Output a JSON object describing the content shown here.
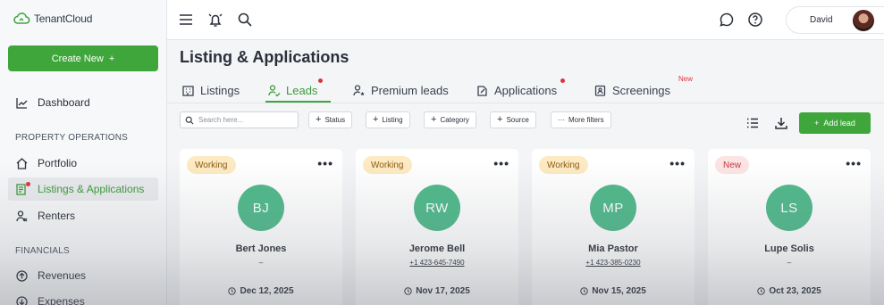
{
  "app": {
    "logo_text": "TenantCloud",
    "accent": "#3fa63c"
  },
  "sidebar": {
    "create_label": "Create New",
    "create_plus": "+",
    "dashboard": "Dashboard",
    "section_property": "PROPERTY OPERATIONS",
    "portfolio": "Portfolio",
    "listings": "Listings & Applications",
    "renters": "Renters",
    "section_financials": "FINANCIALS",
    "revenues": "Revenues",
    "expenses": "Expenses"
  },
  "topbar": {
    "user_name": "David"
  },
  "page": {
    "title": "Listing & Applications"
  },
  "tabs": {
    "listings": "Listings",
    "leads": "Leads",
    "premium": "Premium leads",
    "applications": "Applications",
    "screenings": "Screenings",
    "new_badge": "New"
  },
  "filters": {
    "search_placeholder": "Search here...",
    "status": "Status",
    "listing": "Listing",
    "category": "Category",
    "source": "Source",
    "more": "More filters",
    "add_lead": "Add lead",
    "plus": "+",
    "more_dots": "···"
  },
  "leads": [
    {
      "status": "Working",
      "status_kind": "working",
      "initials": "BJ",
      "name": "Bert Jones",
      "phone": "–",
      "date": "Dec 12, 2025"
    },
    {
      "status": "Working",
      "status_kind": "working",
      "initials": "RW",
      "name": "Jerome Bell",
      "phone": "+1 423-645-7490",
      "date": "Nov 17, 2025"
    },
    {
      "status": "Working",
      "status_kind": "working",
      "initials": "MP",
      "name": "Mia Pastor",
      "phone": "+1 423-385-0230",
      "date": "Nov 15, 2025"
    },
    {
      "status": "New",
      "status_kind": "new",
      "initials": "LS",
      "name": "Lupe Solis",
      "phone": "–",
      "date": "Oct 23, 2025"
    }
  ],
  "card_menu": "•••"
}
